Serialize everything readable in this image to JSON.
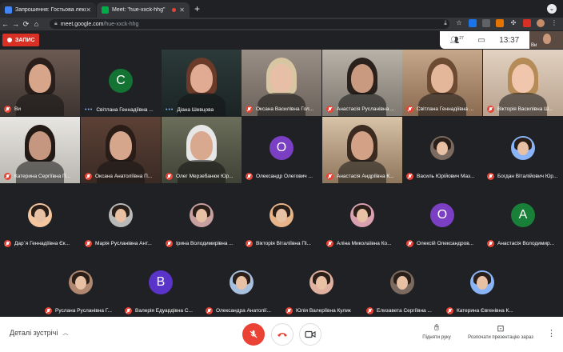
{
  "browser": {
    "tabs": [
      {
        "title": "Запрошення: Гостьова лекція",
        "active": false
      },
      {
        "title": "Meet: \"hue-xxck-hhg\"",
        "active": true
      }
    ],
    "url_host": "meet.google.com",
    "url_path": "/hue-xxck-hhg"
  },
  "meet": {
    "recording_label": "ЗАПИС",
    "participants_count": "27",
    "time": "13:37",
    "self_name": "Ви"
  },
  "tiles": [
    {
      "name": "Ви",
      "type": "video",
      "muted": true
    },
    {
      "name": "Світлана Геннадіївна ...",
      "type": "letter",
      "letter": "С",
      "color": "#137333",
      "muted": false
    },
    {
      "name": "Діана Шевцова",
      "type": "video",
      "muted": false,
      "active": true
    },
    {
      "name": "Оксана Василівна Гол...",
      "type": "video",
      "muted": true
    },
    {
      "name": "Анастасія Русланівна ...",
      "type": "video",
      "muted": true
    },
    {
      "name": "Світлана Геннадіївна ...",
      "type": "video",
      "muted": true
    },
    {
      "name": "Вікторія Василівна Ш...",
      "type": "video",
      "muted": true
    },
    {
      "name": "Катерина Сергіївна П...",
      "type": "video",
      "muted": true
    },
    {
      "name": "Оксана Анатоліївна П...",
      "type": "video",
      "muted": true
    },
    {
      "name": "Олег Мерзебанюк Юр...",
      "type": "video",
      "muted": true
    },
    {
      "name": "Олександр Олегович ...",
      "type": "letter",
      "letter": "О",
      "color": "#7b3fc4",
      "muted": true
    },
    {
      "name": "Анастасія Андріївна К...",
      "type": "video",
      "muted": true
    },
    {
      "name": "Василь Юрійович Маз...",
      "type": "photo",
      "muted": true
    },
    {
      "name": "Богдан Віталійович Юр...",
      "type": "photo",
      "muted": true
    },
    {
      "name": "Дар`я Геннадіївна Єк...",
      "type": "photo",
      "muted": true
    },
    {
      "name": "Марія Русланівна Ант...",
      "type": "photo",
      "muted": true
    },
    {
      "name": "Ірина Володимирівна ...",
      "type": "photo",
      "muted": true
    },
    {
      "name": "Вікторія Віталіївна Пі...",
      "type": "photo",
      "muted": true
    },
    {
      "name": "Аліна Миколаївна Ко...",
      "type": "photo",
      "muted": true
    },
    {
      "name": "Олексій Олександров...",
      "type": "letter",
      "letter": "О",
      "color": "#7b3fc4",
      "muted": true
    },
    {
      "name": "Анастасія Володимир...",
      "type": "letter",
      "letter": "А",
      "color": "#188038",
      "muted": true
    },
    {
      "name": "Руслана Русланівна Г...",
      "type": "photo",
      "muted": true
    },
    {
      "name": "Валерія Едуардівна С...",
      "type": "letter",
      "letter": "В",
      "color": "#5a34c8",
      "muted": true
    },
    {
      "name": "Олександра Анатолії...",
      "type": "photo",
      "muted": true
    },
    {
      "name": "Юлія Валеріївна Кулик",
      "type": "photo",
      "muted": true
    },
    {
      "name": "Елизавета Сергіївна ...",
      "type": "photo",
      "muted": true
    },
    {
      "name": "Катерина Євгенівна К...",
      "type": "photo",
      "muted": true
    }
  ],
  "bottombar": {
    "details_label": "Деталі зустрічі",
    "raise_hand_label": "Підняти руку",
    "present_label": "Розпочати презентацію зараз"
  },
  "colors": {
    "accent": "#1a73e8",
    "danger": "#ea4335",
    "record": "#d93025"
  }
}
